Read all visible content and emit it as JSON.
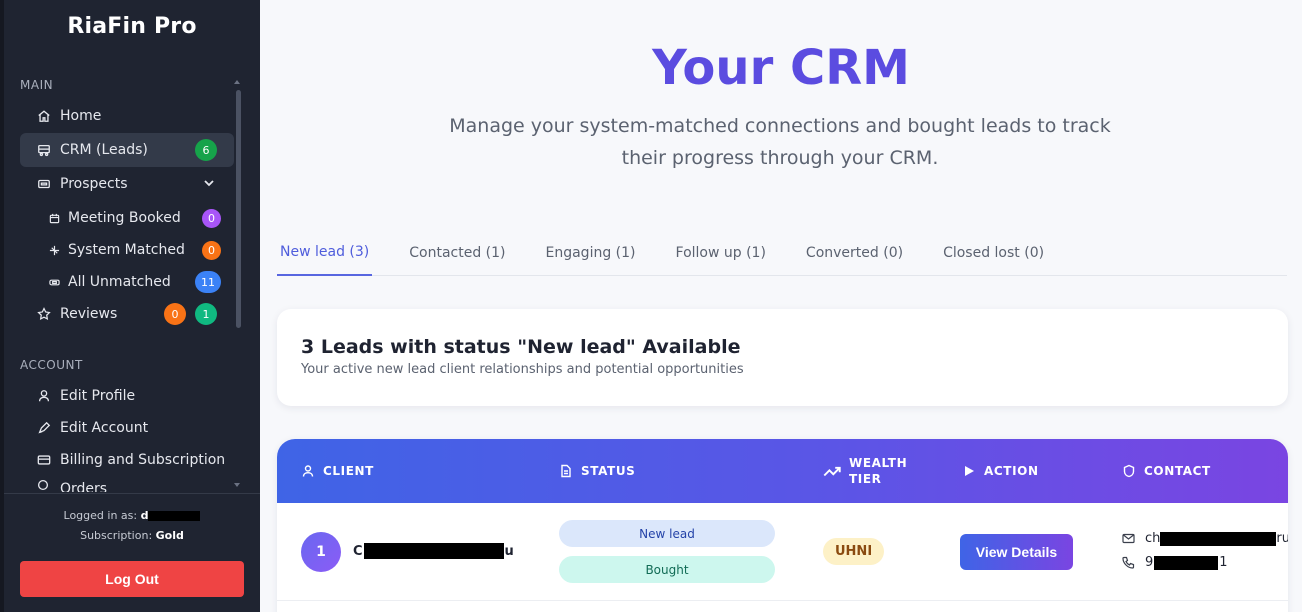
{
  "sidebar": {
    "brand": "RiaFin Pro",
    "main_label": "MAIN",
    "account_label": "ACCOUNT",
    "items": [
      {
        "label": "Home",
        "icon": "home-icon"
      },
      {
        "label": "CRM (Leads)",
        "icon": "crm-icon",
        "badge": "6",
        "badge_color": "#16a34a"
      },
      {
        "label": "Prospects",
        "icon": "prospects-icon"
      },
      {
        "label": "Meeting Booked",
        "icon": "calendar-icon",
        "badge": "0",
        "badge_color": "#a855f7"
      },
      {
        "label": "System Matched",
        "icon": "sparkle-icon",
        "badge": "0",
        "badge_color": "#f97316"
      },
      {
        "label": "All Unmatched",
        "icon": "ticket-icon",
        "badge": "11",
        "badge_color": "#3b82f6"
      },
      {
        "label": "Reviews",
        "icon": "star-icon",
        "badge": "0",
        "badge_color": "#f97316",
        "badge2": "1",
        "badge2_color": "#10b981"
      }
    ],
    "account_items": [
      {
        "label": "Edit Profile",
        "icon": "user-icon"
      },
      {
        "label": "Edit Account",
        "icon": "edit-account-icon"
      },
      {
        "label": "Billing and Subscription",
        "icon": "credit-card-icon"
      },
      {
        "label": "Orders",
        "icon": "orders-icon"
      }
    ],
    "footer": {
      "logged_in_label": "Logged in as:",
      "logged_in_user": "d",
      "subscription_label": "Subscription:",
      "subscription_value": "Gold",
      "logout_label": "Log Out"
    }
  },
  "main": {
    "title": "Your CRM",
    "description": "Manage your system-matched connections and bought leads to track their progress through your CRM.",
    "tabs": [
      {
        "label": "New lead (3)",
        "active": true
      },
      {
        "label": "Contacted (1)"
      },
      {
        "label": "Engaging (1)"
      },
      {
        "label": "Follow up (1)"
      },
      {
        "label": "Converted (0)"
      },
      {
        "label": "Closed lost (0)"
      }
    ],
    "summary": {
      "title": "3 Leads with status \"New lead\" Available",
      "subtitle": "Your active new lead client relationships and potential opportunities"
    },
    "table": {
      "headers": {
        "client": "CLIENT",
        "status": "STATUS",
        "wealth_line1": "WEALTH",
        "wealth_line2": "TIER",
        "action": "ACTION",
        "contact": "CONTACT"
      },
      "rows": [
        {
          "index": "1",
          "name_start": "C",
          "name_end": "u",
          "status1": "New lead",
          "status2": "Bought",
          "tier": "UHNI",
          "action": "View Details",
          "email_start": "ch",
          "email_end": "ru",
          "phone_start": "9",
          "phone_end": "1"
        }
      ]
    }
  },
  "colors": {
    "sidebar_bg": "#1f2431",
    "accent": "#5b4ce0",
    "logout": "#ef4444"
  }
}
